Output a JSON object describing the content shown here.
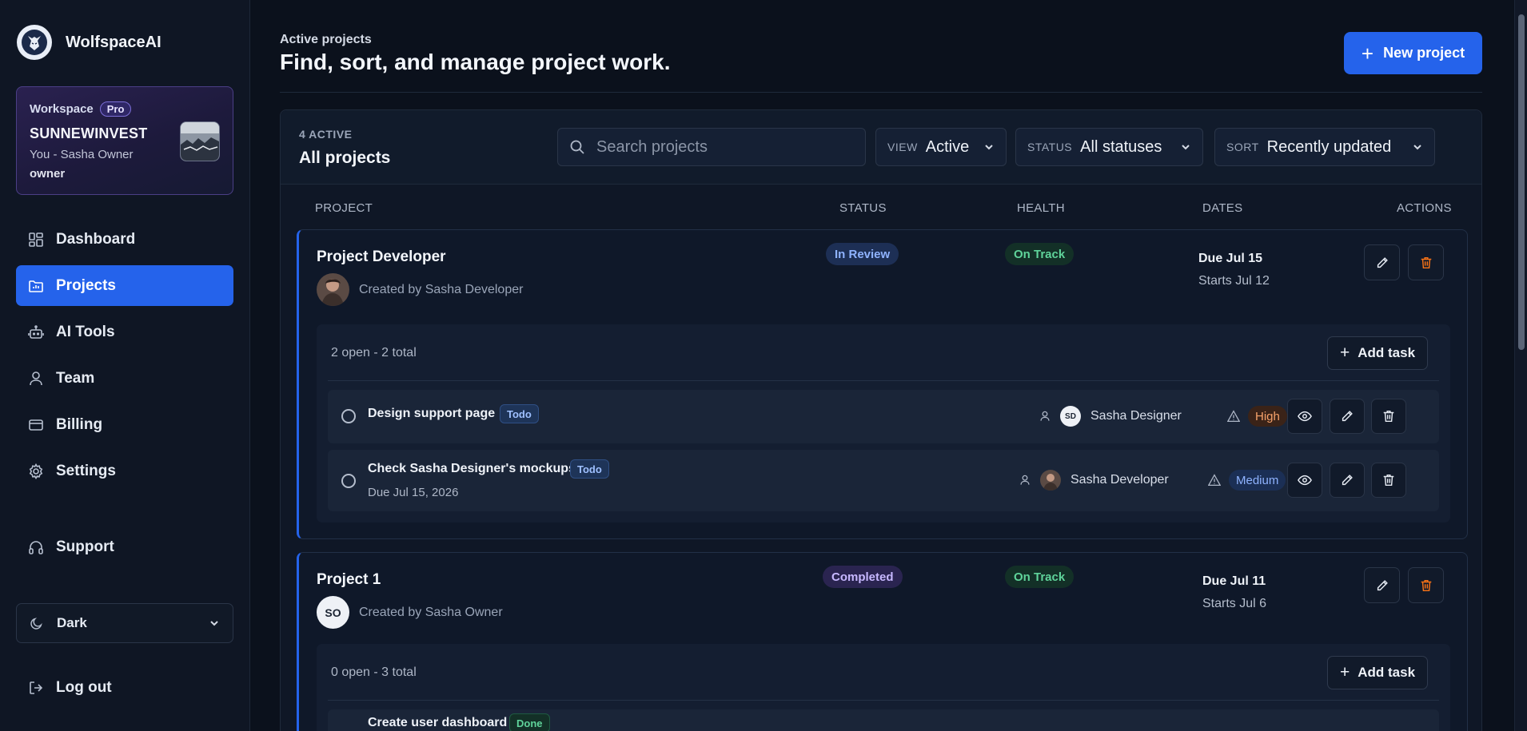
{
  "brand": {
    "name": "WolfspaceAI"
  },
  "workspace": {
    "label": "Workspace",
    "plan": "Pro",
    "name": "SUNNEWINVEST",
    "user_line": "You - Sasha Owner",
    "role": "owner"
  },
  "nav": {
    "items": [
      {
        "label": "Dashboard",
        "icon": "dashboard-icon"
      },
      {
        "label": "Projects",
        "icon": "folder-chart-icon",
        "active": true
      },
      {
        "label": "AI Tools",
        "icon": "bot-icon"
      },
      {
        "label": "Team",
        "icon": "user-icon"
      },
      {
        "label": "Billing",
        "icon": "credit-card-icon"
      },
      {
        "label": "Settings",
        "icon": "gear-icon"
      },
      {
        "label": "Support",
        "icon": "headphones-icon"
      }
    ],
    "theme": "Dark",
    "logout": "Log out"
  },
  "header": {
    "eyebrow": "Active projects",
    "title": "Find, sort, and manage project work.",
    "new_project": "New project"
  },
  "toolbar": {
    "count_label": "4 ACTIVE",
    "title": "All projects",
    "search_placeholder": "Search projects",
    "view_key": "VIEW",
    "view_value": "Active",
    "status_key": "STATUS",
    "status_value": "All statuses",
    "sort_key": "SORT",
    "sort_value": "Recently updated"
  },
  "columns": {
    "project": "PROJECT",
    "status": "STATUS",
    "health": "HEALTH",
    "dates": "DATES",
    "actions": "ACTIONS"
  },
  "projects": [
    {
      "name": "Project Developer",
      "created_by": "Created by Sasha Developer",
      "status": "In Review",
      "health": "On Track",
      "due": "Due Jul 15",
      "starts": "Starts Jul 12",
      "task_summary": "2 open - 2 total",
      "add_task": "Add task",
      "tasks": [
        {
          "title": "Design support page",
          "tag": "Todo",
          "assignee": "Sasha Designer",
          "assignee_initials": "SD",
          "priority": "High"
        },
        {
          "title": "Check Sasha Designer's mockups",
          "tag": "Todo",
          "due": "Due Jul 15, 2026",
          "assignee": "Sasha Developer",
          "priority": "Medium"
        }
      ]
    },
    {
      "name": "Project 1",
      "avatar_initials": "SO",
      "created_by": "Created by Sasha Owner",
      "status": "Completed",
      "health": "On Track",
      "due": "Due Jul 11",
      "starts": "Starts Jul 6",
      "task_summary": "0 open - 3 total",
      "add_task": "Add task",
      "tasks": [
        {
          "title": "Create user dashboard",
          "tag": "Done"
        }
      ]
    }
  ],
  "colors": {
    "accent": "#2563eb",
    "background": "#0b111c",
    "danger": "#f97316",
    "success": "#5fd39a"
  }
}
